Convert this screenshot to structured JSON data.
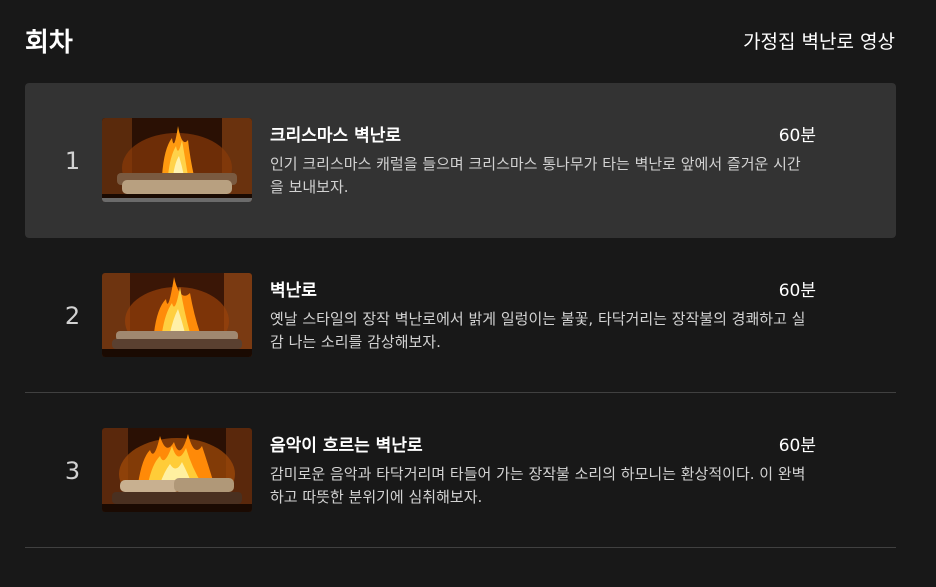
{
  "header": {
    "title": "회차",
    "subtitle": "가정집 벽난로 영상"
  },
  "episodes": [
    {
      "index": "1",
      "title": "크리스마스 벽난로",
      "duration": "60분",
      "description": "인기 크리스마스 캐럴을 들으며 크리스마스 통나무가 타는 벽난로 앞에서 즐거운 시간을 보내보자.",
      "active": true
    },
    {
      "index": "2",
      "title": "벽난로",
      "duration": "60분",
      "description": "옛날 스타일의 장작 벽난로에서 밝게 일렁이는 불꽃, 타닥거리는 장작불의 경쾌하고 실감 나는 소리를 감상해보자.",
      "active": false
    },
    {
      "index": "3",
      "title": "음악이 흐르는 벽난로",
      "duration": "60분",
      "description": "감미로운 음악과 타닥거리며 타들어 가는 장작불 소리의 하모니는 환상적이다. 이 완벽하고 따뜻한 분위기에 심취해보자.",
      "active": false
    }
  ],
  "colors": {
    "background": "#181818",
    "active_row": "#333333",
    "divider": "#404040",
    "flame": "#ffb020"
  }
}
